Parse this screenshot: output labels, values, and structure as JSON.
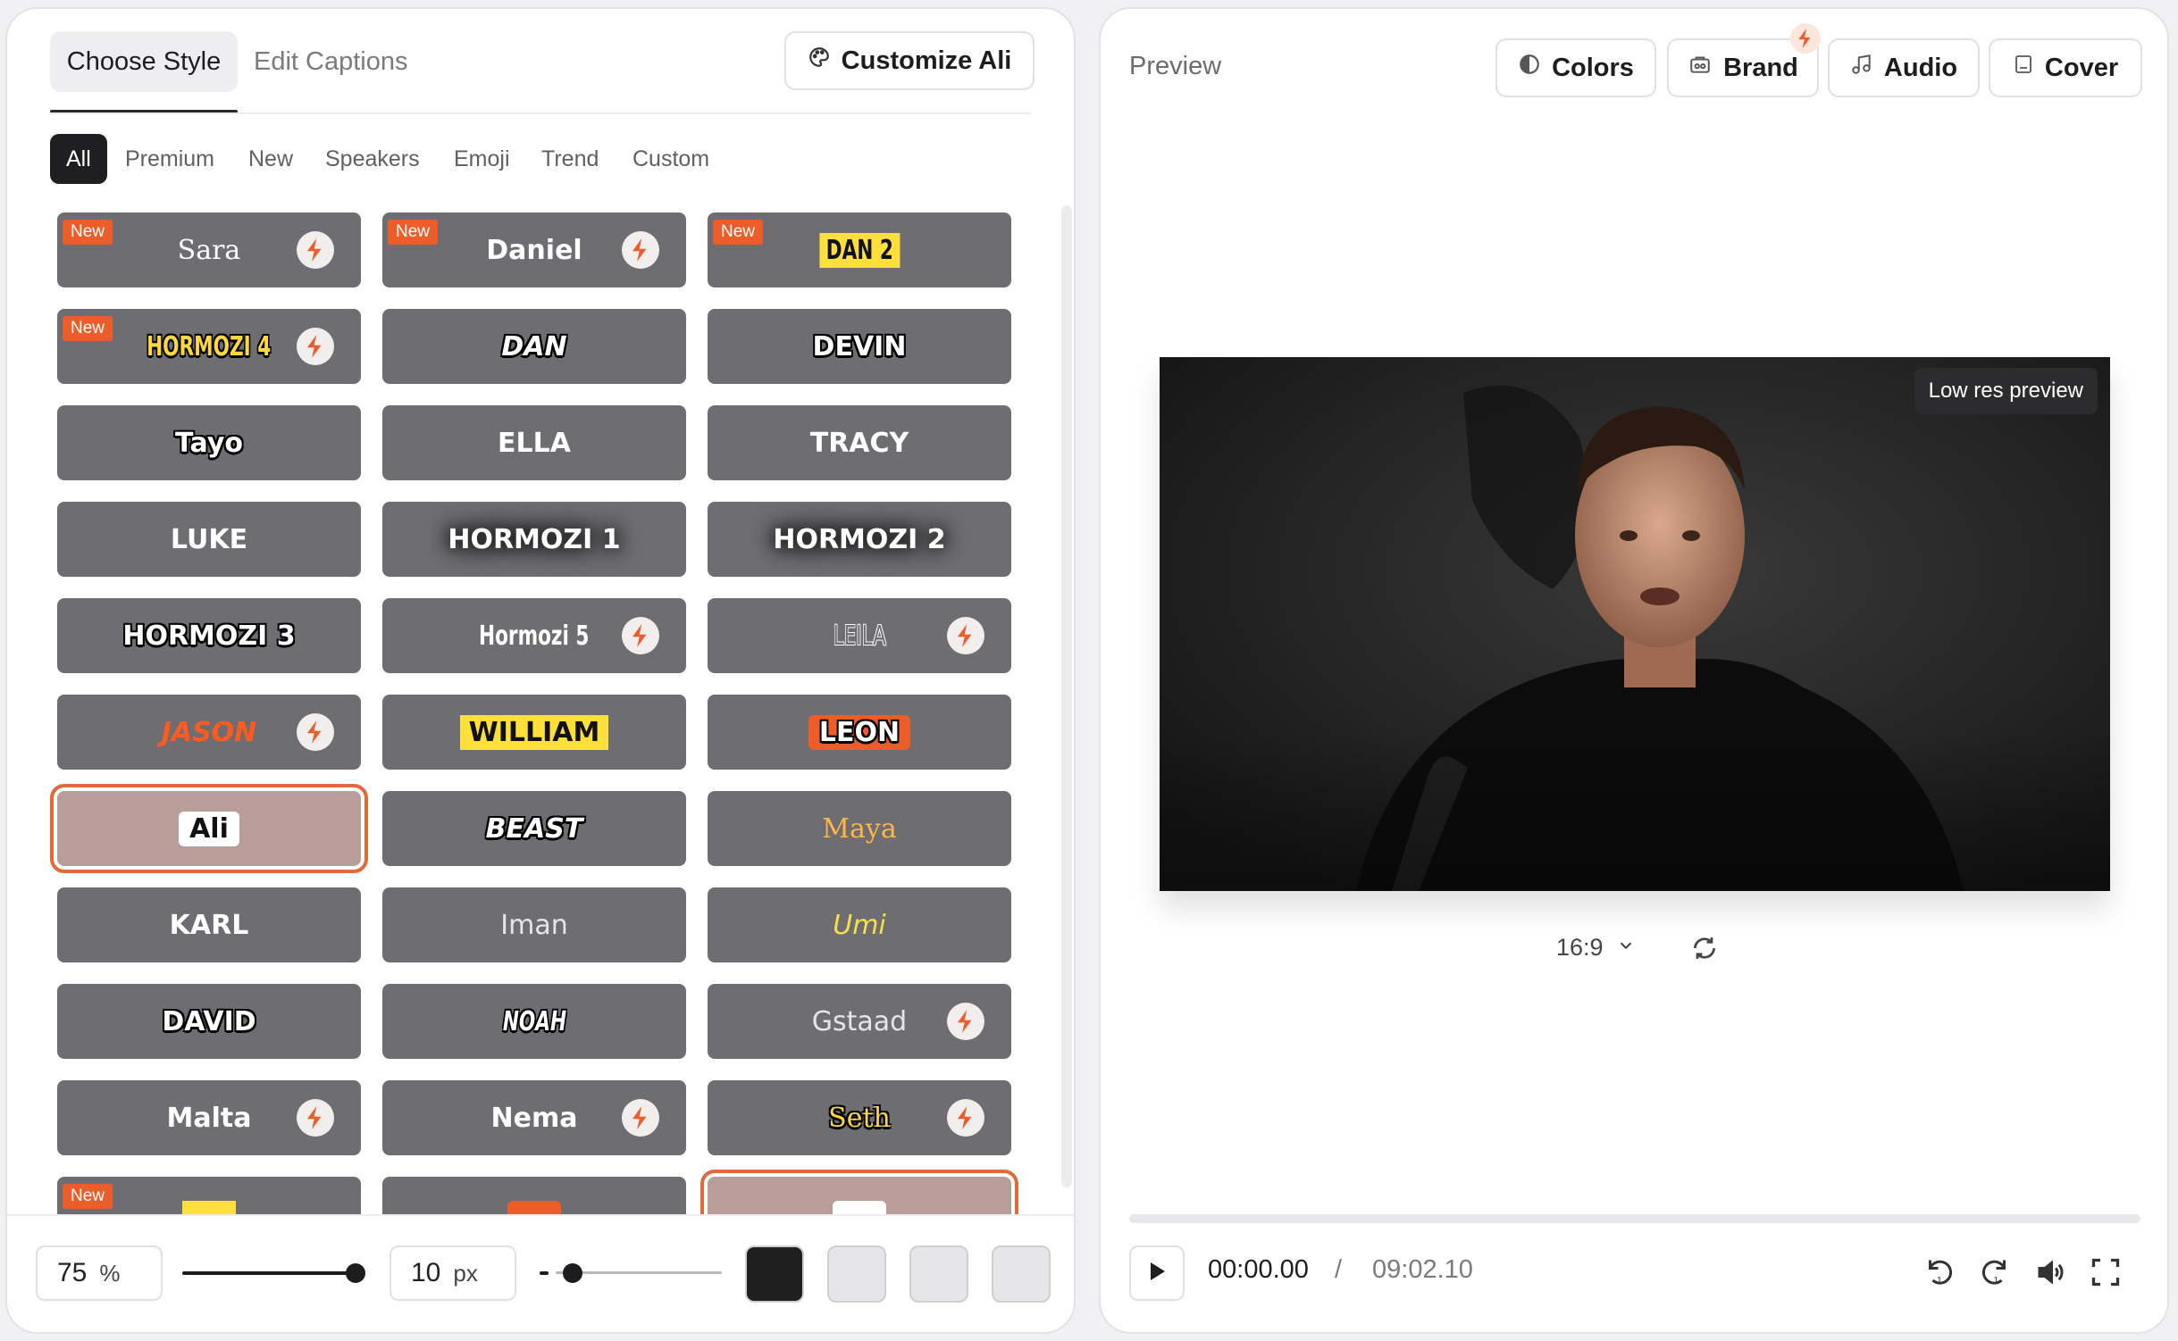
{
  "tabs": {
    "choose_style": "Choose Style",
    "edit_captions": "Edit Captions"
  },
  "customize_label": "Customize Ali",
  "filters": [
    "All",
    "Premium",
    "New",
    "Speakers",
    "Emoji",
    "Trend",
    "Custom"
  ],
  "active_filter": "All",
  "styles": [
    {
      "name": "Sara",
      "new": true,
      "premium": true,
      "style": "s-serif"
    },
    {
      "name": "Daniel",
      "new": true,
      "premium": true,
      "style": ""
    },
    {
      "name": "DAN 2",
      "new": true,
      "premium": false,
      "style": "s-cond s-yellowbox"
    },
    {
      "name": "HORMOZI 4",
      "new": true,
      "premium": true,
      "style": "s-cond s-yellow s-stroke"
    },
    {
      "name": "DAN",
      "new": false,
      "premium": false,
      "style": "s-italic s-stroke"
    },
    {
      "name": "DEVIN",
      "new": false,
      "premium": false,
      "style": "s-stroke"
    },
    {
      "name": "Tayo",
      "new": false,
      "premium": false,
      "style": "s-stroke"
    },
    {
      "name": "ELLA",
      "new": false,
      "premium": false,
      "style": ""
    },
    {
      "name": "TRACY",
      "new": false,
      "premium": false,
      "style": ""
    },
    {
      "name": "LUKE",
      "new": false,
      "premium": false,
      "style": ""
    },
    {
      "name": "HORMOZI 1",
      "new": false,
      "premium": false,
      "style": "s-glow"
    },
    {
      "name": "HORMOZI 2",
      "new": false,
      "premium": false,
      "style": "s-glow"
    },
    {
      "name": "HORMOZI 3",
      "new": false,
      "premium": false,
      "style": "s-stroke"
    },
    {
      "name": "Hormozi 5",
      "new": false,
      "premium": true,
      "style": "s-cond"
    },
    {
      "name": "LEILA",
      "new": false,
      "premium": true,
      "style": "s-cond s-outline"
    },
    {
      "name": "JASON",
      "new": false,
      "premium": true,
      "style": "s-italic s-orange"
    },
    {
      "name": "WILLIAM",
      "new": false,
      "premium": false,
      "style": "s-yellowbox"
    },
    {
      "name": "LEON",
      "new": false,
      "premium": false,
      "style": "s-orangebox s-stroke"
    },
    {
      "name": "Ali",
      "new": false,
      "premium": false,
      "style": "s-whitebox",
      "selected": true
    },
    {
      "name": "BEAST",
      "new": false,
      "premium": false,
      "style": "s-italic s-stroke"
    },
    {
      "name": "Maya",
      "new": false,
      "premium": false,
      "style": "s-serif s-gold"
    },
    {
      "name": "KARL",
      "new": false,
      "premium": false,
      "style": ""
    },
    {
      "name": "Iman",
      "new": false,
      "premium": false,
      "style": "s-light"
    },
    {
      "name": "Umi",
      "new": false,
      "premium": false,
      "style": "s-lime"
    },
    {
      "name": "DAVID",
      "new": false,
      "premium": false,
      "style": "s-stroke"
    },
    {
      "name": "NOAH",
      "new": false,
      "premium": false,
      "style": "s-cond s-italic s-stroke"
    },
    {
      "name": "Gstaad",
      "new": false,
      "premium": true,
      "style": "s-light"
    },
    {
      "name": "Malta",
      "new": false,
      "premium": true,
      "style": ""
    },
    {
      "name": "Nema",
      "new": false,
      "premium": true,
      "style": ""
    },
    {
      "name": "Seth",
      "new": false,
      "premium": true,
      "style": "s-serif s-yellow s-stroke"
    },
    {
      "name": "",
      "new": true,
      "premium": false,
      "style": "s-yellowbox"
    },
    {
      "name": "",
      "new": false,
      "premium": false,
      "style": "s-orangebox"
    },
    {
      "name": "",
      "new": false,
      "premium": false,
      "style": "s-whitebox",
      "selected": true
    }
  ],
  "badge_new": "New",
  "font_size": {
    "value": "75",
    "unit": "%",
    "level": 1.0
  },
  "spacing": {
    "value": "10",
    "unit": "px",
    "level": 0.1
  },
  "swatches": [
    "#1f1f1f",
    "#e6e6e8",
    "#e6e6e8",
    "#e6e6e8"
  ],
  "preview": {
    "title": "Preview",
    "buttons": {
      "colors": "Colors",
      "brand": "Brand",
      "audio": "Audio",
      "cover": "Cover"
    },
    "low_res": "Low res preview",
    "aspect_ratio": "16:9",
    "time_current": "00:00.00",
    "time_separator": "/",
    "time_total": "09:02.10"
  },
  "accent": "#ec5d2a"
}
